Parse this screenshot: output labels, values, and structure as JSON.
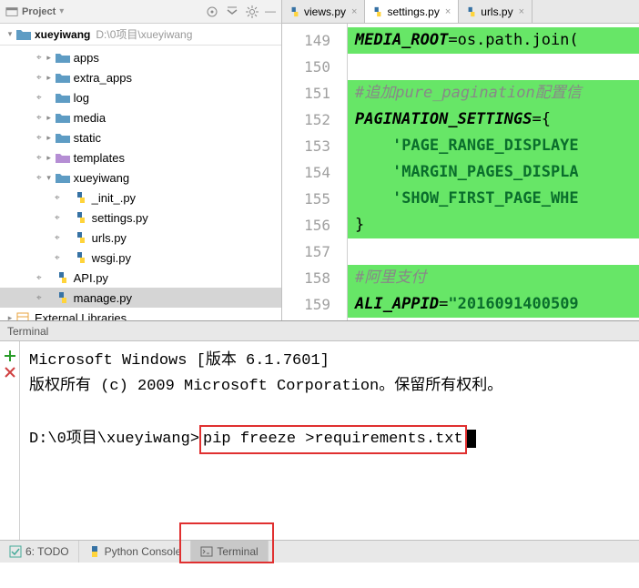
{
  "sidebar": {
    "title": "Project",
    "breadcrumb_root": "xueyiwang",
    "breadcrumb_path": "D:\\0项目\\xueyiwang",
    "tree": [
      {
        "label": "apps",
        "type": "folder",
        "indent": 2,
        "arrow": ">"
      },
      {
        "label": "extra_apps",
        "type": "folder",
        "indent": 2,
        "arrow": ">"
      },
      {
        "label": "log",
        "type": "folder",
        "indent": 2,
        "arrow": ""
      },
      {
        "label": "media",
        "type": "folder",
        "indent": 2,
        "arrow": ">"
      },
      {
        "label": "static",
        "type": "folder",
        "indent": 2,
        "arrow": ">"
      },
      {
        "label": "templates",
        "type": "tpl",
        "indent": 2,
        "arrow": ">"
      },
      {
        "label": "xueyiwang",
        "type": "folder",
        "indent": 2,
        "arrow": "v"
      },
      {
        "label": "_init_.py",
        "type": "py",
        "indent": 3,
        "arrow": ""
      },
      {
        "label": "settings.py",
        "type": "py",
        "indent": 3,
        "arrow": ""
      },
      {
        "label": "urls.py",
        "type": "py",
        "indent": 3,
        "arrow": ""
      },
      {
        "label": "wsgi.py",
        "type": "py",
        "indent": 3,
        "arrow": ""
      },
      {
        "label": "API.py",
        "type": "py",
        "indent": 2,
        "arrow": ""
      },
      {
        "label": "manage.py",
        "type": "py",
        "indent": 2,
        "arrow": "",
        "selected": true
      }
    ],
    "ext_lib": "External Libraries"
  },
  "tabs": [
    {
      "label": "views.py",
      "active": false
    },
    {
      "label": "settings.py",
      "active": true
    },
    {
      "label": "urls.py",
      "active": false
    }
  ],
  "code": {
    "lines": [
      {
        "n": "149",
        "kind": "hl",
        "html": "<span class='c-ident'>MEDIA_ROOT</span><span class='c-eq'>=os.path.join(</span>"
      },
      {
        "n": "150",
        "kind": "hl",
        "html": ""
      },
      {
        "n": "151",
        "kind": "hl",
        "html": "<span class='c-comment'>#追加pure_pagination配置信</span>"
      },
      {
        "n": "152",
        "kind": "hl",
        "html": "<span class='c-ident'>PAGINATION_SETTINGS</span><span class='c-eq'>={</span>"
      },
      {
        "n": "153",
        "kind": "hl",
        "html": "    <span class='c-str'>'PAGE_RANGE_DISPLAYE</span>"
      },
      {
        "n": "154",
        "kind": "hl",
        "html": "    <span class='c-str'>'MARGIN_PAGES_DISPLA</span>"
      },
      {
        "n": "155",
        "kind": "hl",
        "html": "    <span class='c-str'>'SHOW_FIRST_PAGE_WHE</span>"
      },
      {
        "n": "156",
        "kind": "hl",
        "html": "<span class='c-eq'>}</span>"
      },
      {
        "n": "157",
        "kind": "plain",
        "html": ""
      },
      {
        "n": "158",
        "kind": "hl",
        "html": "<span class='c-comment'>#阿里支付</span>"
      },
      {
        "n": "159",
        "kind": "hl",
        "html": "<span class='c-ident'>ALI_APPID</span><span class='c-eq'>=</span><span class='c-str'>\"2016091400509</span>"
      }
    ]
  },
  "terminal": {
    "title": "Terminal",
    "line1": "Microsoft Windows [版本 6.1.7601]",
    "line2": "版权所有 (c) 2009 Microsoft Corporation。保留所有权利。",
    "prompt": "D:\\0项目\\xueyiwang>",
    "command": "pip freeze >requirements.txt"
  },
  "status": {
    "todo": "6: TODO",
    "pyconsole": "Python Console",
    "terminal": "Terminal"
  }
}
